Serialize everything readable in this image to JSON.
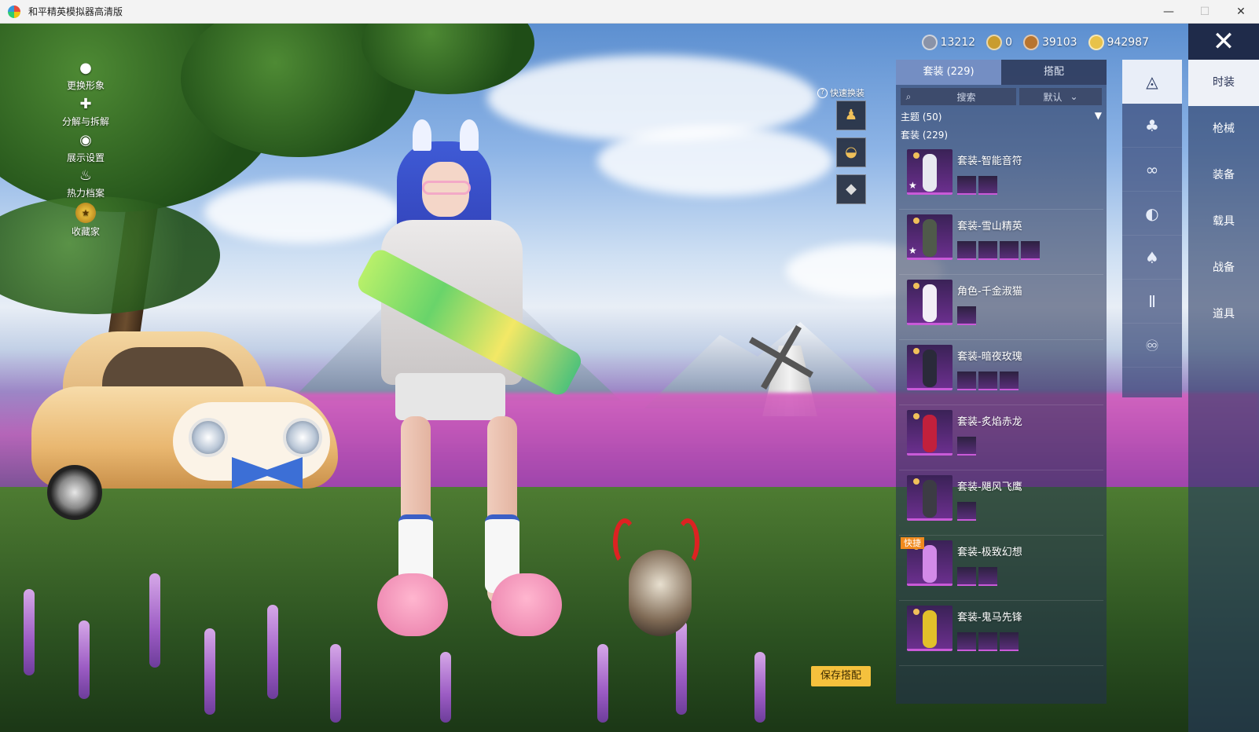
{
  "window": {
    "title": "和平精英模拟器高清版",
    "minimize": "—",
    "maximize": "☐",
    "close": "✕"
  },
  "left_tools": [
    {
      "label": "更换形象",
      "icon": "person-icon",
      "glyph": "●"
    },
    {
      "label": "分解与拆解",
      "icon": "puzzle-icon",
      "glyph": "✚"
    },
    {
      "label": "展示设置",
      "icon": "eye-icon",
      "glyph": "◉"
    },
    {
      "label": "热力档案",
      "icon": "flame-icon",
      "glyph": "♨"
    },
    {
      "label": "收藏家",
      "icon": "collector-badge-icon",
      "glyph": "★"
    }
  ],
  "currencies": [
    {
      "icon": "bp-coin-icon",
      "value": "13212",
      "color": "#8a93a8"
    },
    {
      "icon": "a-coin-icon",
      "value": "0",
      "color": "#c99c2e"
    },
    {
      "icon": "bronze-coin-icon",
      "value": "39103",
      "color": "#b8742e"
    },
    {
      "icon": "gold-coin-icon",
      "value": "942987",
      "color": "#e8c24a"
    }
  ],
  "close_button": "✕",
  "quick_switch": {
    "help": "?",
    "label": "快速换装",
    "slots": [
      "outfit-slot-icon",
      "helmet-slot-icon",
      "diamond-slot-icon"
    ]
  },
  "panel": {
    "tabs": [
      {
        "label": "套装 (229)",
        "active": true
      },
      {
        "label": "搭配",
        "active": false
      }
    ],
    "search_placeholder": "搜索",
    "sort_label": "默认",
    "theme_filter": "主题 (50)",
    "count_label": "套装 (229)",
    "outfits": [
      {
        "name": "套装-智能音符",
        "star": true,
        "quick": false,
        "parts": 2,
        "fig": "#e8e8f0"
      },
      {
        "name": "套装-雪山精英",
        "star": true,
        "quick": false,
        "parts": 4,
        "fig": "#4f5a4a"
      },
      {
        "name": "角色-千金淑猫",
        "star": false,
        "quick": false,
        "parts": 1,
        "fig": "#f2eef6"
      },
      {
        "name": "套装-暗夜玫瑰",
        "star": false,
        "quick": false,
        "parts": 3,
        "fig": "#2a2a3a"
      },
      {
        "name": "套装-炙焰赤龙",
        "star": false,
        "quick": false,
        "parts": 1,
        "fig": "#c2203c"
      },
      {
        "name": "套装-飓风飞鹰",
        "star": false,
        "quick": false,
        "parts": 1,
        "fig": "#3c3c44"
      },
      {
        "name": "套装-极致幻想",
        "star": false,
        "quick": true,
        "parts": 2,
        "fig": "#d28ae8"
      },
      {
        "name": "套装-鬼马先锋",
        "star": false,
        "quick": false,
        "parts": 3,
        "fig": "#e2c02a"
      }
    ],
    "quick_tag": "快捷"
  },
  "save_button": "保存搭配",
  "categories": [
    {
      "icon": "hat-icon",
      "glyph": "◬"
    },
    {
      "icon": "top-icon",
      "glyph": "♣"
    },
    {
      "icon": "glasses-icon",
      "glyph": "∞"
    },
    {
      "icon": "mask-icon",
      "glyph": "◐"
    },
    {
      "icon": "jacket-icon",
      "glyph": "♠"
    },
    {
      "icon": "pants-icon",
      "glyph": "Ⅱ"
    },
    {
      "icon": "shoes-icon",
      "glyph": "♾"
    }
  ],
  "right_menu": [
    {
      "label": "时装",
      "active": true
    },
    {
      "label": "枪械",
      "active": false
    },
    {
      "label": "装备",
      "active": false
    },
    {
      "label": "载具",
      "active": false
    },
    {
      "label": "战备",
      "active": false
    },
    {
      "label": "道具",
      "active": false
    }
  ]
}
